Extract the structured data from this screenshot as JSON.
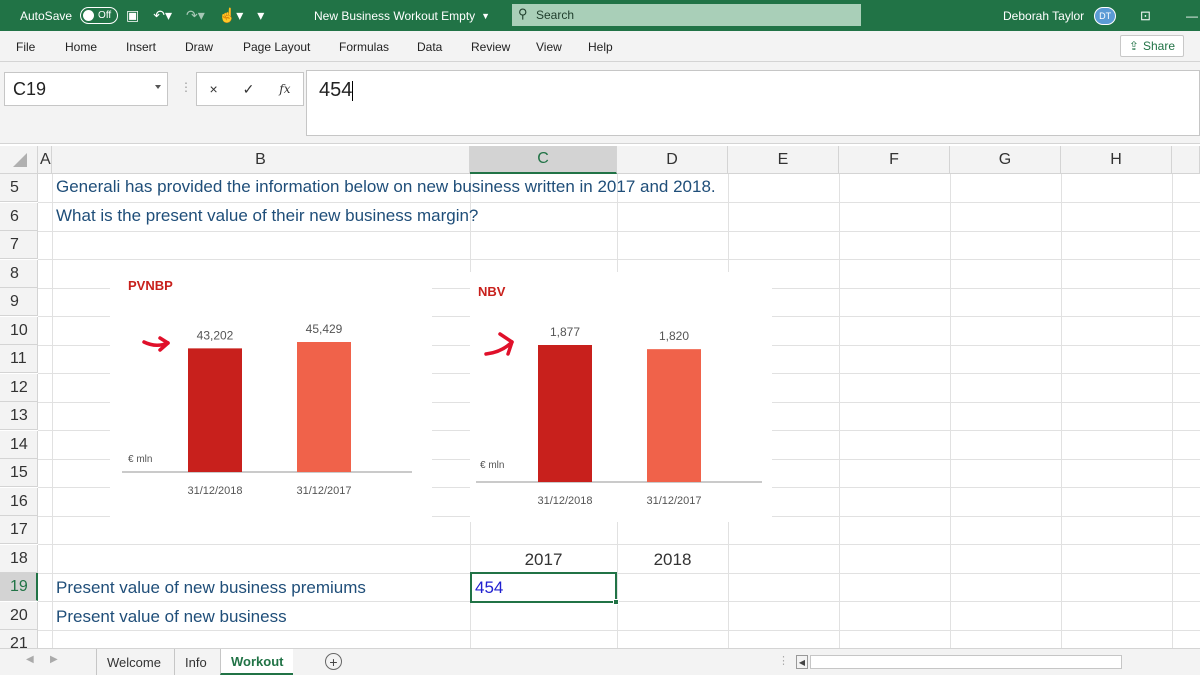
{
  "titlebar": {
    "autosave_label": "AutoSave",
    "autosave_state": "Off",
    "doc_title": "New Business Workout Empty",
    "search_label": "Search",
    "user_name": "Deborah Taylor",
    "user_initials": "DT"
  },
  "menu": {
    "tabs": [
      "File",
      "Home",
      "Insert",
      "Draw",
      "Page Layout",
      "Formulas",
      "Data",
      "Review",
      "View",
      "Help"
    ],
    "share_label": "Share"
  },
  "formula_bar": {
    "cell_ref": "C19",
    "cancel": "×",
    "enter": "✓",
    "fx": "fx",
    "value": "454"
  },
  "columns": [
    "A",
    "B",
    "C",
    "D",
    "E",
    "F",
    "G",
    "H"
  ],
  "rows": [
    "5",
    "6",
    "7",
    "8",
    "9",
    "10",
    "11",
    "12",
    "13",
    "14",
    "15",
    "16",
    "17",
    "18",
    "19",
    "20",
    "21"
  ],
  "cells": {
    "r5": "Generali has provided the information below on new business written in 2017 and 2018.",
    "r6": "What is the present value of their new business margin?",
    "c18": "2017",
    "d18": "2018",
    "b19": "Present value of new business premiums",
    "c19": "454",
    "b20": "Present value of new business"
  },
  "chart_data": [
    {
      "type": "bar",
      "title": "PVNBP",
      "ylabel": "€ mln",
      "categories": [
        "31/12/2018",
        "31/12/2017"
      ],
      "values": [
        43202,
        45429
      ],
      "value_labels": [
        "43,202",
        "45,429"
      ],
      "colors": [
        "#c8201c",
        "#f0624a"
      ],
      "arrow_on": "31/12/2018"
    },
    {
      "type": "bar",
      "title": "NBV",
      "ylabel": "€ mln",
      "categories": [
        "31/12/2018",
        "31/12/2017"
      ],
      "values": [
        1877,
        1820
      ],
      "value_labels": [
        "1,877",
        "1,820"
      ],
      "colors": [
        "#c8201c",
        "#f0624a"
      ],
      "arrow_on": "31/12/2018"
    }
  ],
  "sheets": {
    "tabs": [
      "Welcome",
      "Info",
      "Workout"
    ],
    "active": "Workout",
    "add": "+"
  }
}
